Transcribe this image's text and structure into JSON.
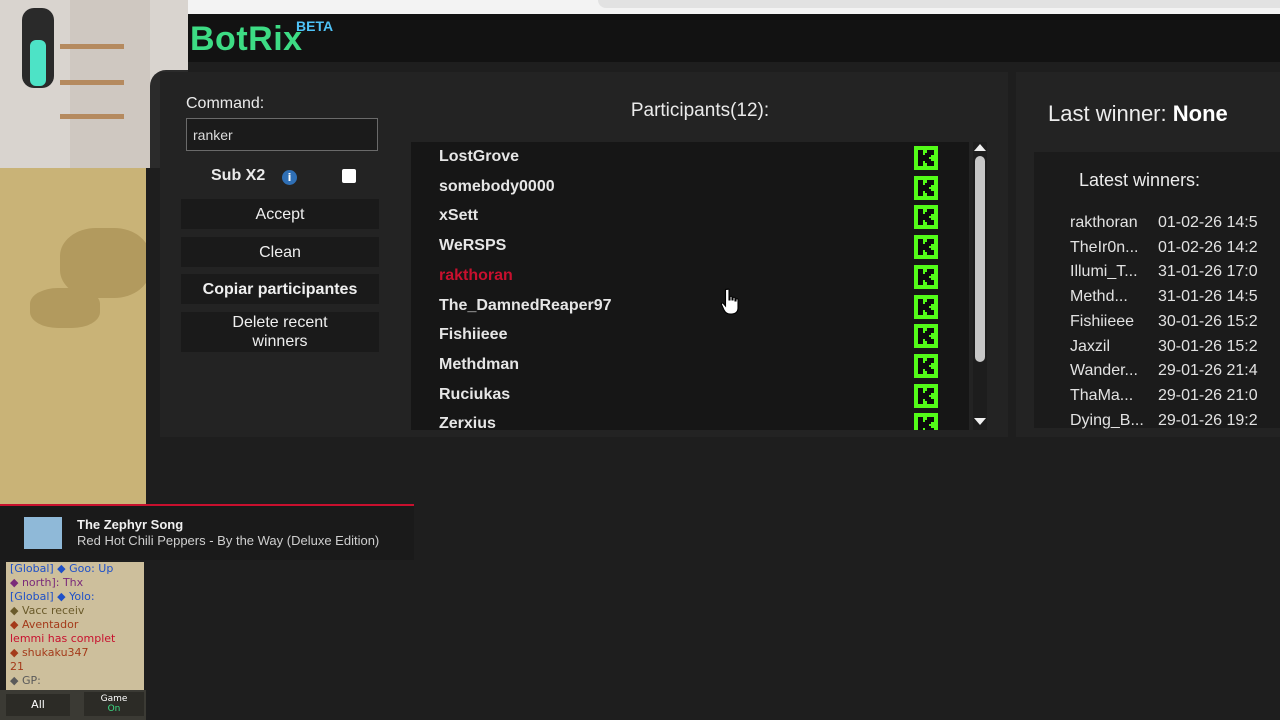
{
  "app": {
    "logo": "BotRix",
    "badge": "BETA"
  },
  "command": {
    "label": "Command:",
    "value": "ranker"
  },
  "sub": {
    "label": "Sub X2",
    "info_icon": "info-icon",
    "checked": false
  },
  "buttons": {
    "accept": "Accept",
    "clean": "Clean",
    "copy": "Copiar participantes",
    "delete": "Delete recent winners"
  },
  "participants": {
    "title": "Participants(12):",
    "items": [
      {
        "name": "LostGrove",
        "winner": false
      },
      {
        "name": "somebody0000",
        "winner": false
      },
      {
        "name": "xSett",
        "winner": false
      },
      {
        "name": "WeRSPS",
        "winner": false
      },
      {
        "name": "rakthoran",
        "winner": true
      },
      {
        "name": "The_DamnedReaper97",
        "winner": false
      },
      {
        "name": "Fishiieee",
        "winner": false
      },
      {
        "name": "Methdman",
        "winner": false
      },
      {
        "name": "Ruciukas",
        "winner": false
      },
      {
        "name": "Zerxius",
        "winner": false
      }
    ],
    "kick_icon": "kick-logo-icon",
    "kick_color": "#53fc18",
    "winner_color": "#c8102e"
  },
  "last_winner": {
    "label": "Last winner:",
    "value": "None"
  },
  "latest_winners": {
    "title": "Latest winners:",
    "items": [
      {
        "name": "rakthoran",
        "date": "01-02-26 14:5"
      },
      {
        "name": "TheIr0n...",
        "date": "01-02-26 14:2"
      },
      {
        "name": "Illumi_T...",
        "date": "31-01-26 17:0"
      },
      {
        "name": "Methd...",
        "date": "31-01-26 14:5"
      },
      {
        "name": "Fishiieee",
        "date": "30-01-26 15:2"
      },
      {
        "name": "Jaxzil",
        "date": "30-01-26 15:2"
      },
      {
        "name": "Wander...",
        "date": "29-01-26 21:4"
      },
      {
        "name": "ThaMa...",
        "date": "29-01-26 21:0"
      },
      {
        "name": "Dying_B...",
        "date": "29-01-26 19:2"
      }
    ]
  },
  "now_playing": {
    "title": "The Zephyr Song",
    "artist": "Red Hot Chili Peppers - By the Way (Deluxe Edition)"
  },
  "game_chat": {
    "lines": [
      {
        "text": "[Global] ◆ Goo: Up",
        "color": "#1e50c8"
      },
      {
        "text": "◆ north]: Thx",
        "color": "#7a2a7a"
      },
      {
        "text": "[Global] ◆ Yolo:",
        "color": "#1e50c8"
      },
      {
        "text": "◆ Vacc receiv",
        "color": "#6a5a2a"
      },
      {
        "text": "◆ Aventador",
        "color": "#a43a1a"
      },
      {
        "text": "lemmi has complet",
        "color": "#c8102e"
      },
      {
        "text": "◆ shukaku347",
        "color": "#a43a1a"
      },
      {
        "text": "21",
        "color": "#a43a1a"
      },
      {
        "text": "◆ GP:",
        "color": "#5a5a5a"
      }
    ],
    "tab_all": "All",
    "tab_game": "Game",
    "tab_game_state": "On"
  }
}
